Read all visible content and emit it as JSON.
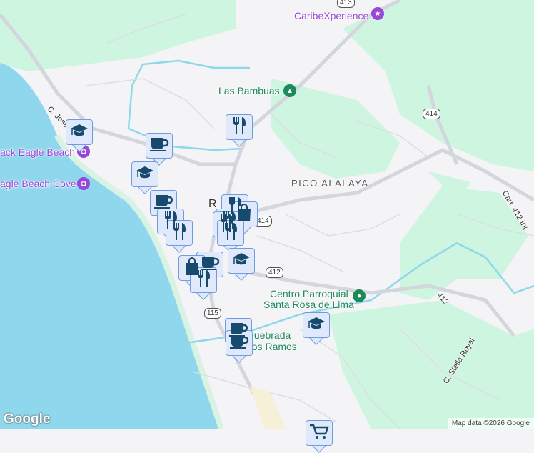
{
  "labels": {
    "caribe": "CaribeXperience",
    "bambuas": "Las Bambuas",
    "pico": "PICO ALALAYA",
    "centro1": "Centro Parroquial",
    "centro2": "Santa Rosa de Lima",
    "quebrada1": "Quebrada",
    "quebrada2": "Los Ramos",
    "beach1": "ack Eagle Beach",
    "beach2": "agle Beach Cove",
    "town_r": "R"
  },
  "roads": {
    "jose": "C. Jose P",
    "carr412": "Carr. 412 Int",
    "r412": "412",
    "stella": "C. Stella Royal"
  },
  "shields": [
    "413",
    "414",
    "414",
    "412",
    "115"
  ],
  "markers": [
    {
      "type": "school"
    },
    {
      "type": "cafe"
    },
    {
      "type": "school"
    },
    {
      "type": "cafe"
    },
    {
      "type": "restaurant"
    },
    {
      "type": "restaurant"
    },
    {
      "type": "restaurant"
    },
    {
      "type": "restaurant"
    },
    {
      "type": "shopping"
    },
    {
      "type": "restaurant"
    },
    {
      "type": "restaurant"
    },
    {
      "type": "restaurant"
    },
    {
      "type": "school"
    },
    {
      "type": "cafe"
    },
    {
      "type": "shopping"
    },
    {
      "type": "restaurant"
    },
    {
      "type": "school"
    },
    {
      "type": "cafe"
    },
    {
      "type": "cafe"
    },
    {
      "type": "grocery"
    }
  ],
  "colors": {
    "water": "#8fd7ec",
    "park": "#cdf5df",
    "land": "#f4f3f5",
    "marker_bg": "#dfe9fb",
    "marker_border": "#6f9be0",
    "icon": "#174a6d",
    "poi_purple": "#9a46d8",
    "poi_green": "#1e8a5c"
  },
  "attribution": "Map data ©2026 Google",
  "logo": "Google"
}
